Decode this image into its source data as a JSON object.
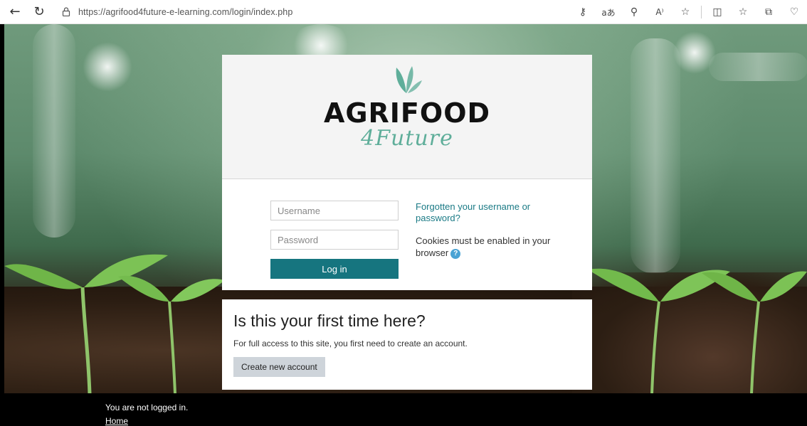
{
  "browser": {
    "url": "https://agrifood4future-e-learning.com/login/index.php"
  },
  "brand": {
    "name": "AGRIFOOD",
    "tagline": "4Future",
    "accent_color": "#5fae9a"
  },
  "login": {
    "username_placeholder": "Username",
    "password_placeholder": "Password",
    "login_button": "Log in",
    "forgot_link": "Forgotten your username or password?",
    "cookies_note": "Cookies must be enabled in your browser",
    "button_color": "#16757f"
  },
  "signup": {
    "title": "Is this your first time here?",
    "text": "For full access to this site, you first need to create an account.",
    "button": "Create new account"
  },
  "footer": {
    "status": "You are not logged in.",
    "home_link": "Home"
  }
}
